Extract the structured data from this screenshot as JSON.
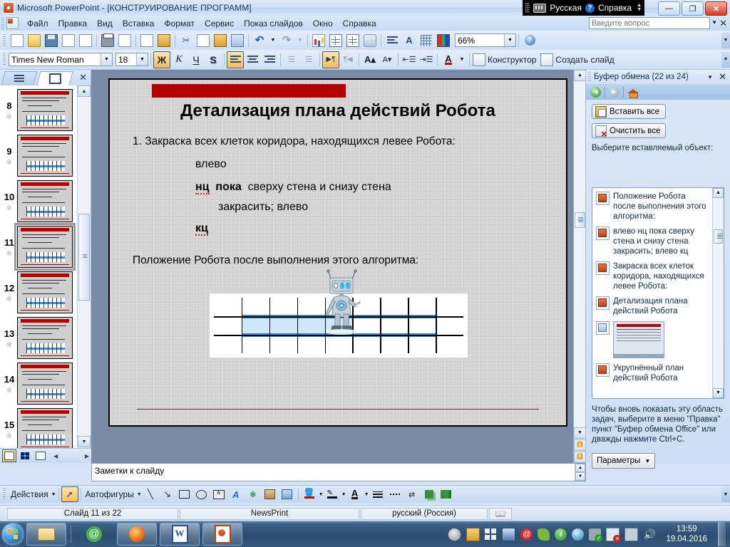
{
  "window": {
    "title": "Microsoft PowerPoint - [КОНСТРУИРОВАНИЕ ПРОГРАММ]",
    "app_icon": "powerpoint-icon",
    "minimize": "—",
    "restore": "❐",
    "close": "✕"
  },
  "language_bar": {
    "keyboard_icon": "keyboard-icon",
    "language": "Русская",
    "help_icon": "help-icon",
    "help": "Справка"
  },
  "menu": {
    "items": [
      "Файл",
      "Правка",
      "Вид",
      "Вставка",
      "Формат",
      "Сервис",
      "Показ слайдов",
      "Окно",
      "Справка"
    ],
    "ask_placeholder": "Введите вопрос",
    "ask_value": "",
    "close_label": "✕"
  },
  "standard_toolbar": {
    "zoom_value": "66%",
    "buttons": [
      "new-document",
      "open",
      "save",
      "save-as-web",
      "email-attachment",
      "print",
      "print-preview",
      "spelling",
      "research",
      "cut",
      "copy",
      "paste",
      "format-painter",
      "undo",
      "redo",
      "insert-chart",
      "insert-table",
      "insert-diagram",
      "insert-hyperlink",
      "show-formatting",
      "clear-formatting",
      "show-grid",
      "color-scheme"
    ],
    "overflow": "toolbar-options"
  },
  "formatting_toolbar": {
    "font_name": "Times New Roman",
    "font_size": "18",
    "bold": "Ж",
    "italic": "К",
    "underline": "Ч",
    "shadow": "S",
    "design_label": "Конструктор",
    "new_slide_label": "Создать слайд",
    "buttons": [
      "align-left",
      "align-center",
      "align-right",
      "numbered-list",
      "bulleted-list",
      "increase-text",
      "decrease-text",
      "grow-font",
      "shrink-font",
      "promote",
      "demote",
      "font-color"
    ]
  },
  "left_pane": {
    "tab_outline": "outline-tab",
    "tab_slides": "slides-tab",
    "close_label": "✕",
    "thumbnails": [
      {
        "number": "8",
        "selected": false
      },
      {
        "number": "9",
        "selected": false
      },
      {
        "number": "10",
        "selected": false
      },
      {
        "number": "11",
        "selected": true
      },
      {
        "number": "12",
        "selected": false
      },
      {
        "number": "13",
        "selected": false
      },
      {
        "number": "14",
        "selected": false
      },
      {
        "number": "15",
        "selected": false
      }
    ],
    "view_buttons": [
      "normal-view",
      "slide-sorter-view",
      "slide-show-view"
    ]
  },
  "slide": {
    "title": "Детализация плана действий Робота",
    "bullet_1": "1. Закраска всех клеток коридора, находящихся  левее Робота:",
    "code_line_1": "влево",
    "code_line_2_kw1": "нц",
    "code_line_2_kw2": "пока",
    "code_line_2_rest": "сверху  стена  и  снизу  стена",
    "code_line_3": "закрасить;   влево",
    "code_line_4": "кц",
    "position_text": "Положение Робота после выполнения этого алгоритма:",
    "grid": {
      "columns": 9,
      "rows": 3,
      "corridor_row_index": 1,
      "filled_cells": [
        1,
        2,
        3,
        4
      ],
      "robot_column_index": 4,
      "corridor_color": "#2f8ede",
      "filled_color": "#cfe6fb"
    },
    "accent_bar_color": "#b40000",
    "bottom_rule_color": "#8b1a1a"
  },
  "notes": {
    "text": "Заметки к слайду"
  },
  "task_pane": {
    "title": "Буфер обмена (22 из 24)",
    "dropdown": "▼",
    "close": "✕",
    "nav": {
      "back": "back-icon",
      "forward": "forward-icon",
      "home": "home-icon"
    },
    "paste_all": "Вставить все",
    "clear_all": "Очистить все",
    "select_hint": "Выберите вставляемый объект:",
    "items": [
      {
        "type": "text",
        "text": "Положение Робота после выполнения этого алгоритма:"
      },
      {
        "type": "text",
        "text": "влево нц пока сверху стена и снизу стена закрасить; влево кц"
      },
      {
        "type": "text",
        "text": "Закраска всех клеток коридора, находящихся левее Робота:"
      },
      {
        "type": "text",
        "text": "Детализация плана действий Робота"
      },
      {
        "type": "image",
        "text": ""
      },
      {
        "type": "text",
        "text": "Укрупнённый план действий Робота"
      }
    ],
    "footer": "Чтобы вновь показать эту область задач, выберите в меню \"Правка\" пункт \"Буфер обмена Office\" или дважды нажмите Ctrl+C.",
    "options_label": "Параметры"
  },
  "drawing_toolbar": {
    "actions_label": "Действия",
    "autoshapes_label": "Автофигуры",
    "buttons": [
      "select-arrow",
      "line",
      "arrow",
      "rectangle",
      "oval",
      "text-box",
      "wordart",
      "diagram",
      "clip-art",
      "insert-picture",
      "fill-color",
      "line-color",
      "font-color",
      "line-style",
      "dash-style",
      "arrow-style",
      "shadow-style",
      "3d-style"
    ]
  },
  "status_bar": {
    "slide_counter": "Слайд 11 из 22",
    "design_template": "NewsPrint",
    "language": "русский (Россия)",
    "spelling_icon": "spelling-status-icon"
  },
  "taskbar": {
    "start": "start-orb",
    "apps": [
      "explorer-icon",
      "mail-at-icon",
      "firefox-icon",
      "word-icon",
      "powerpoint-icon"
    ],
    "tray": [
      "disc-icon",
      "clipboard-icon",
      "windows-icon",
      "update-icon",
      "at-icon",
      "nvidia-icon",
      "info-icon",
      "drop-icon",
      "usb-safe-icon",
      "network-flag-icon",
      "monitor-icon",
      "volume-icon"
    ],
    "time": "13:59",
    "date": "19.04.2016"
  }
}
